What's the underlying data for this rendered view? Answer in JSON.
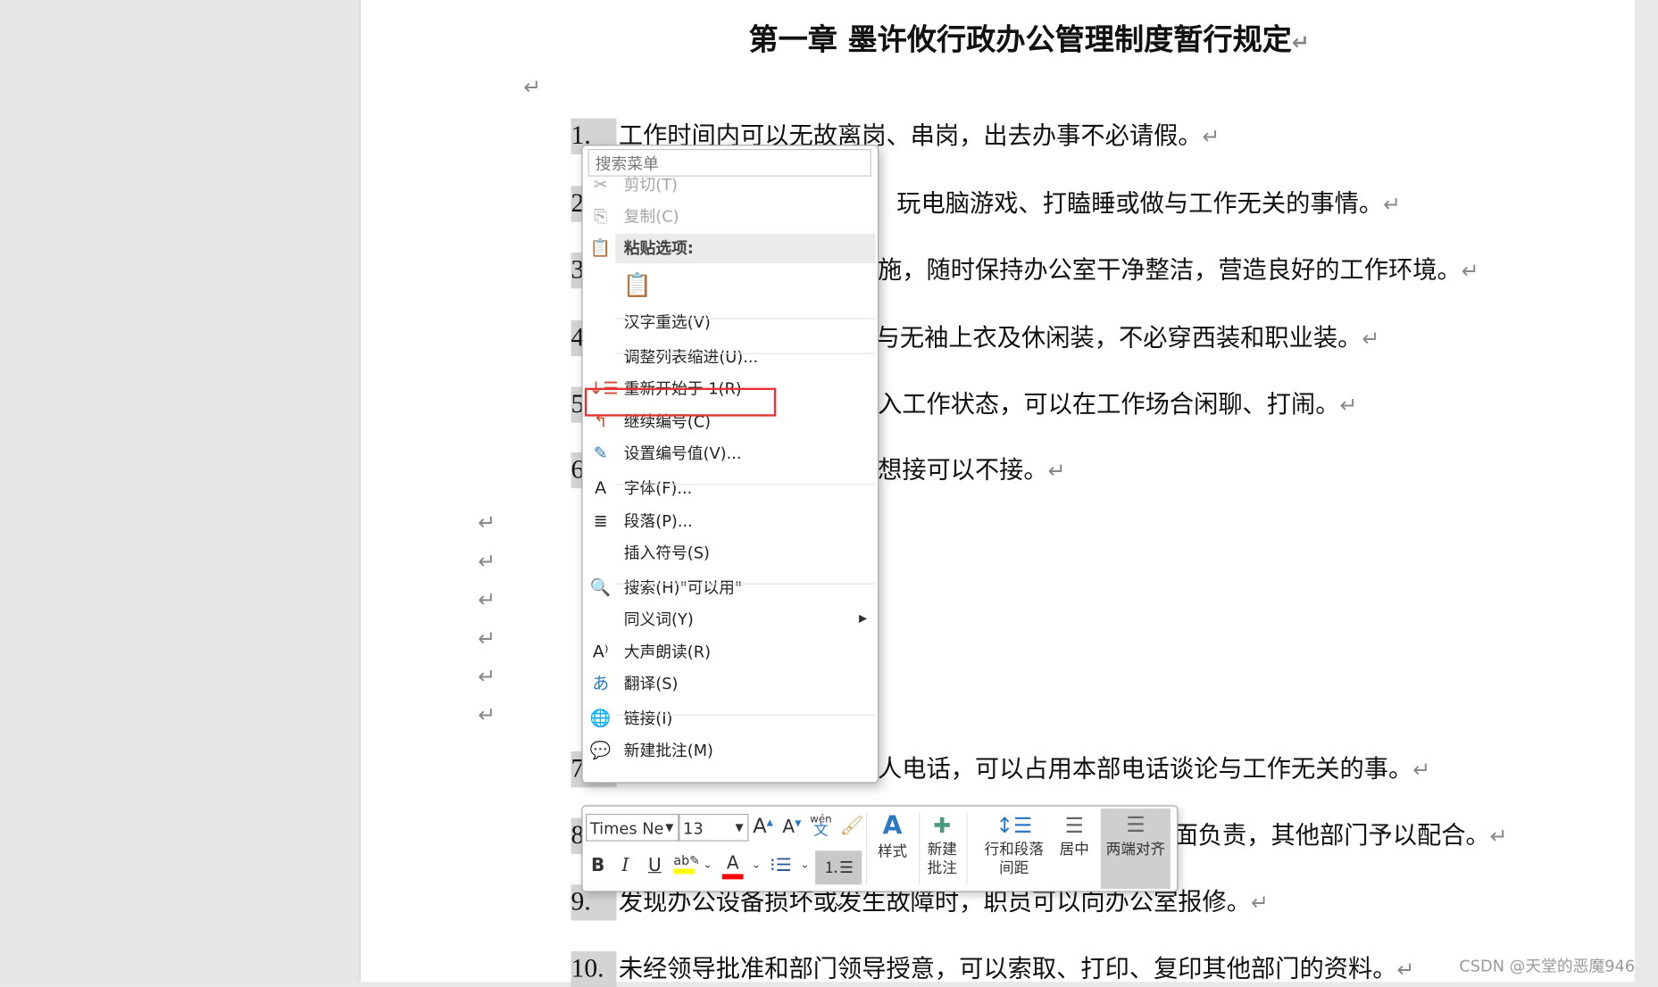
{
  "document": {
    "title": "第一章  墨许攸行政办公管理制度暂行规定",
    "return_mark": "↵",
    "items": [
      {
        "num": "1.",
        "text": "工作时间内可以无故离岗、串岗，出去办事不必请假。"
      },
      {
        "num": "2",
        "text": "玩电脑游戏、打瞌睡或做与工作无关的事情。"
      },
      {
        "num": "3",
        "text": "施，随时保持办公室干净整洁，营造良好的工作环境。"
      },
      {
        "num": "4",
        "text": "与无袖上衣及休闲装，不必穿西装和职业装。"
      },
      {
        "num": "5",
        "text": "入工作状态，可以在工作场合闲聊、打闹。"
      },
      {
        "num": "6",
        "text": "想接可以不接。"
      },
      {
        "num": "7",
        "text": "人电话，可以占用本部电话谈论与工作无关的事。"
      },
      {
        "num": "8",
        "text": "面负责，其他部门予以配合。"
      },
      {
        "num": "9.",
        "text": "发现办公设备损坏或发生故障时，职员可以向办公室报修。"
      },
      {
        "num": "10.",
        "text": "未经领导批准和部门领导授意，可以索取、打印、复印其他部门的资料。"
      }
    ]
  },
  "context_menu": {
    "search_placeholder": "搜索菜单",
    "items": [
      {
        "label": "剪切(T)",
        "icon": "✂",
        "name": "cut",
        "disabled": true
      },
      {
        "label": "复制(C)",
        "icon": "⎘",
        "name": "copy",
        "disabled": true
      },
      {
        "label": "粘贴选项:",
        "icon": "📋",
        "name": "paste-options",
        "header": true
      },
      {
        "label": "",
        "icon": "📋",
        "name": "paste-keep-text"
      },
      {
        "label": "汉字重选(V)",
        "icon": "",
        "name": "reconvert"
      },
      {
        "label": "调整列表缩进(U)...",
        "icon": "",
        "name": "adjust-list-indent"
      },
      {
        "label": "重新开始于 1(R)",
        "icon": "↓☰",
        "name": "restart-at-1",
        "highlighted": true
      },
      {
        "label": "继续编号(C)",
        "icon": "↰",
        "name": "continue-numbering"
      },
      {
        "label": "设置编号值(V)...",
        "icon": "✎",
        "name": "set-numbering-value"
      },
      {
        "label": "字体(F)...",
        "icon": "A",
        "name": "font"
      },
      {
        "label": "段落(P)...",
        "icon": "≣",
        "name": "paragraph"
      },
      {
        "label": "插入符号(S)",
        "icon": "",
        "name": "insert-symbol"
      },
      {
        "label": "搜索(H)\"可以用\"",
        "icon": "🔍",
        "name": "search"
      },
      {
        "label": "同义词(Y)",
        "icon": "",
        "name": "synonyms",
        "submenu": true
      },
      {
        "label": "大声朗读(R)",
        "icon": "A⁾",
        "name": "read-aloud"
      },
      {
        "label": "翻译(S)",
        "icon": "あ",
        "name": "translate"
      },
      {
        "label": "链接(I)",
        "icon": "🌐",
        "name": "link"
      },
      {
        "label": "新建批注(M)",
        "icon": "💬",
        "name": "new-comment"
      }
    ]
  },
  "mini_toolbar": {
    "font_name": "Times Ne",
    "font_size": "13",
    "grow_font": "A",
    "shrink_font": "A",
    "phonetic_top": "wén",
    "phonetic_bottom": "文",
    "bold": "B",
    "italic": "I",
    "underline": "U",
    "highlight_color": "#ffff00",
    "font_color": "#ff0000",
    "styles_label": "样式",
    "new_comment_label": [
      "新建",
      "批注"
    ],
    "line_spacing_label": [
      "行和段落",
      "间距"
    ],
    "center_label": "居中",
    "justify_label": "两端对齐"
  },
  "watermark": "CSDN @天堂的恶魔946",
  "colors": {
    "accent": "#2b579a",
    "highlight_box": "#e53232"
  }
}
